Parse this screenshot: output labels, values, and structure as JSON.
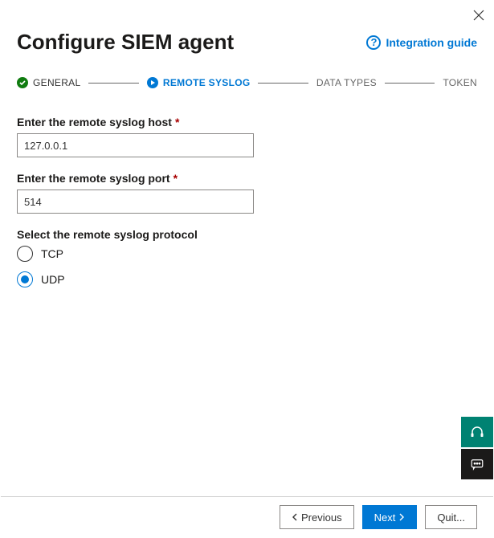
{
  "header": {
    "title": "Configure SIEM agent",
    "guide_label": "Integration guide"
  },
  "stepper": {
    "step1": "GENERAL",
    "step2": "REMOTE SYSLOG",
    "step3": "DATA TYPES",
    "step4": "TOKEN"
  },
  "form": {
    "host_label": "Enter the remote syslog host",
    "host_value": "127.0.0.1",
    "port_label": "Enter the remote syslog port",
    "port_value": "514",
    "protocol_label": "Select the remote syslog protocol",
    "tcp_label": "TCP",
    "udp_label": "UDP"
  },
  "footer": {
    "previous": "Previous",
    "next": "Next",
    "quit": "Quit..."
  }
}
